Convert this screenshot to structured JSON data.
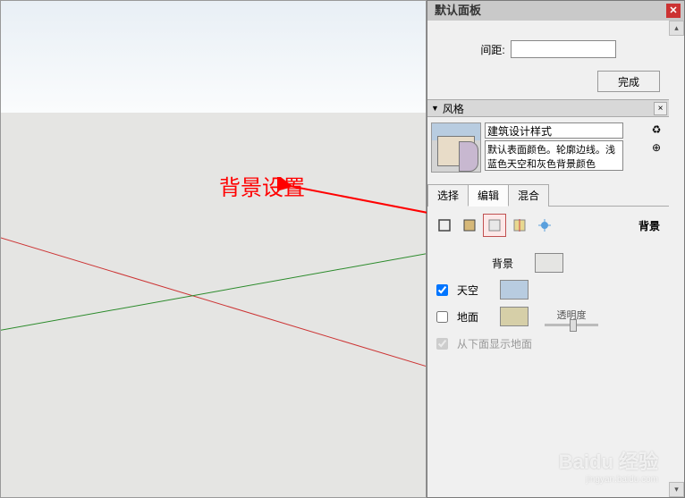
{
  "panel_title": "默认面板",
  "spacing_label": "间距:",
  "finish_btn": "完成",
  "style_section": "风格",
  "style_name": "建筑设计样式",
  "style_desc": "默认表面颜色。轮廓边线。浅蓝色天空和灰色背景颜色",
  "tabs": {
    "select": "选择",
    "edit": "编辑",
    "mix": "混合"
  },
  "edit_section_label": "背景",
  "bg_label": "背景",
  "sky_label": "天空",
  "ground_label": "地面",
  "transparency_label": "透明度",
  "show_ground_below": "从下面显示地面",
  "annotation": "背景设置",
  "watermark": "Baidu 经验",
  "watermark_sub": "jingyan.baidu.com"
}
